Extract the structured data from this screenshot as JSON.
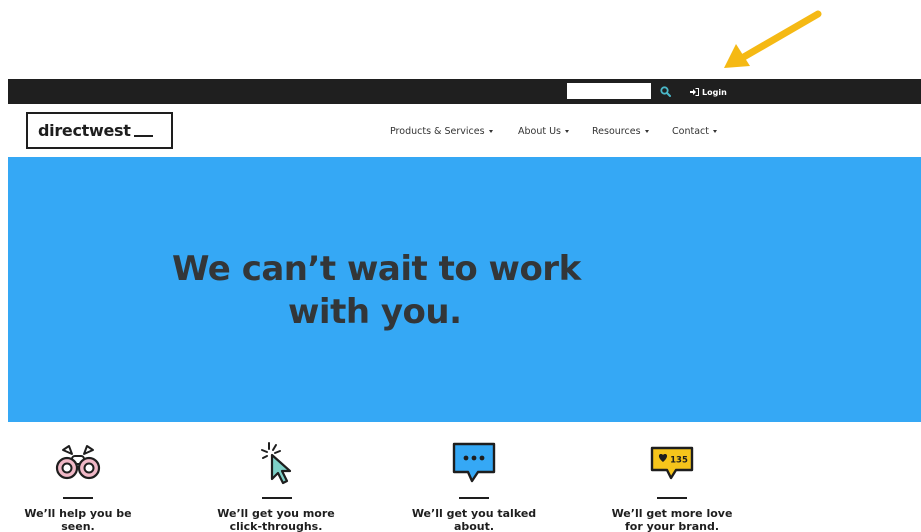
{
  "header": {
    "search": {
      "value": "",
      "placeholder": ""
    },
    "login_label": "Login",
    "logo_text": "directwest"
  },
  "nav": {
    "items": [
      {
        "label": "Products & Services"
      },
      {
        "label": "About Us"
      },
      {
        "label": "Resources"
      },
      {
        "label": "Contact"
      }
    ]
  },
  "hero": {
    "line1": "We can’t wait to work",
    "line2": "with you."
  },
  "features": [
    {
      "icon": "binoculars-icon",
      "line1": "We’ll help you be",
      "line2": "seen."
    },
    {
      "icon": "cursor-click-icon",
      "line1": "We’ll get you more",
      "line2": "click-throughs."
    },
    {
      "icon": "speech-bubble-icon",
      "line1": "We’ll get you talked",
      "line2": "about."
    },
    {
      "icon": "heart-badge-icon",
      "line1": "We’ll get more love",
      "line2": "for your brand.",
      "badge_count": "135"
    }
  ],
  "colors": {
    "topbar": "#1f1f1f",
    "hero": "#35a8f5",
    "arrow": "#f5b914",
    "accent": "#4ab8c8"
  }
}
